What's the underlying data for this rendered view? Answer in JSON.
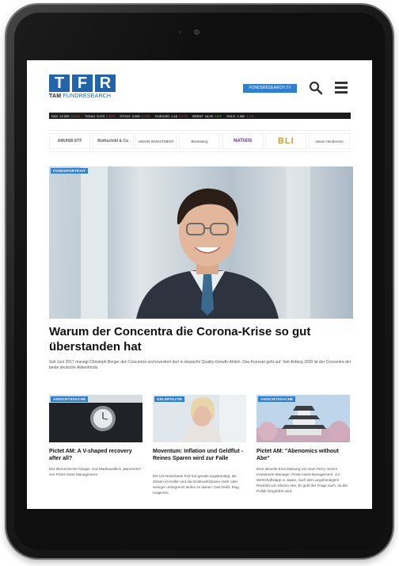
{
  "site": {
    "logo_letters": [
      "T",
      "F",
      "R"
    ],
    "logo_sub_brand": "TAM",
    "logo_sub_name": "FUNDRESEARCH",
    "nav_button": "FONDSRESEARCH.TV"
  },
  "ticker": [
    {
      "name": "DAX",
      "value": "12.009",
      "change": "0,12%",
      "up": false
    },
    {
      "name": "TXDAX",
      "value": "3.079",
      "change": "0,11%",
      "up": false
    },
    {
      "name": "STOXX",
      "value": "3.289",
      "change": "0,13%",
      "up": false
    },
    {
      "name": "EUR/USD",
      "value": "1,18",
      "change": "0,27%",
      "up": false
    },
    {
      "name": "BRENT",
      "value": "44,09",
      "change": "1,6%",
      "up": true
    },
    {
      "name": "GOLD",
      "value": "1.982",
      "change": "1,1%",
      "up": false
    }
  ],
  "partners": [
    "AMUNDI ETF",
    "Rothschild & Co",
    "UNION INVESTMENT",
    "Berenberg",
    "NATIXIS",
    "BLI",
    "Janus Henderson"
  ],
  "hero": {
    "badge": "FONDSPORTRAIT",
    "headline": "Warum der Concentra die Corona-Krise so gut überstanden hat",
    "lead": "Seit Juni 2017 managt Christoph Berger den Concentra und investiert dort in deutsche Quality-Growth-Aktien. Das Konzept geht auf: Seit Anfang 2020 ist der Concentra der beste deutsche Aktienfonds."
  },
  "cards": [
    {
      "badge": "ANSICHTSSACHE",
      "title": "Pictet AM: A V-shaped recovery after all?",
      "text": "Der ökonomische Anlage- und Marktausblick „Barometer“ von Pictet Asset Management."
    },
    {
      "badge": "GELDPOLITIK",
      "title": "Moventum: Inflation und Geldflut - Reines Sparen wird zur Falle",
      "text": "Die US-Notenbank Fed hat gerade angekündigt, die Zinsen im Koller und die Geldmarktzinsen mehr oder weniger unbegrenzt laufen zu lassen. Das heißt: Klug reagieren."
    },
    {
      "badge": "ANSICHTSSACHE",
      "title": "Pictet AM: \"Abenomics without Abe\"",
      "text": "Eine aktuelle Einschätzung von Sam Perry, Senior Investment Manager, Pictet Asset Management, zur Wirtschaftslage in Japan, nach dem angekündigten Rücktritt von Shinzo Abe. Er geht der Frage nach, ob die Politik fortgeführt wird."
    }
  ],
  "colors": {
    "brand_blue": "#1c5fa8",
    "accent_blue": "#2f7fd0",
    "ticker_bg": "#1b1b1b",
    "ticker_down": "#e05555",
    "ticker_up": "#46c46a"
  }
}
